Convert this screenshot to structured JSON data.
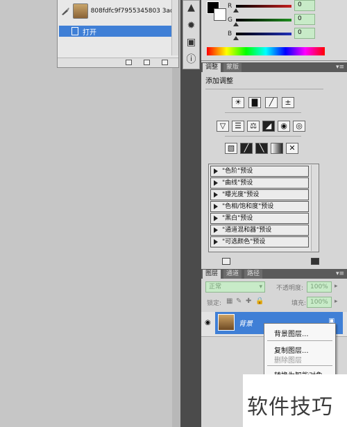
{
  "history": {
    "filename": "808fdfc9f7955345803 3ad...",
    "open_label": "打开"
  },
  "tools": {
    "icons": [
      "cursor-icon",
      "sun-icon",
      "image-icon",
      "info-icon"
    ]
  },
  "color": {
    "r_label": "R",
    "g_label": "G",
    "b_label": "B",
    "r_value": "0",
    "g_value": "0",
    "b_value": "0",
    "r_color": "#c51f1f",
    "g_color": "#1f8f1f",
    "b_color": "#1f2fb8"
  },
  "adjustments": {
    "tab_active": "调整",
    "tab_other": "蒙版",
    "title": "添加调整",
    "presets": [
      "\"色阶\"预设",
      "\"曲线\"预设",
      "\"曝光度\"预设",
      "\"色相/饱和度\"预设",
      "\"黑白\"预设",
      "\"通道混和器\"预设",
      "\"可选颜色\"预设"
    ]
  },
  "layers": {
    "tabs": [
      "图层",
      "通道",
      "路径"
    ],
    "blend_mode": "正常",
    "opacity_label": "不透明度:",
    "opacity_value": "100%",
    "lock_label": "锁定:",
    "fill_label": "填充:",
    "fill_value": "100%",
    "layer_name": "背景"
  },
  "context_menu": {
    "items": [
      "背景图层...",
      "复制图层...",
      "删除图层",
      "转换为智能对象"
    ]
  },
  "watermark": {
    "text": "软件技巧"
  }
}
